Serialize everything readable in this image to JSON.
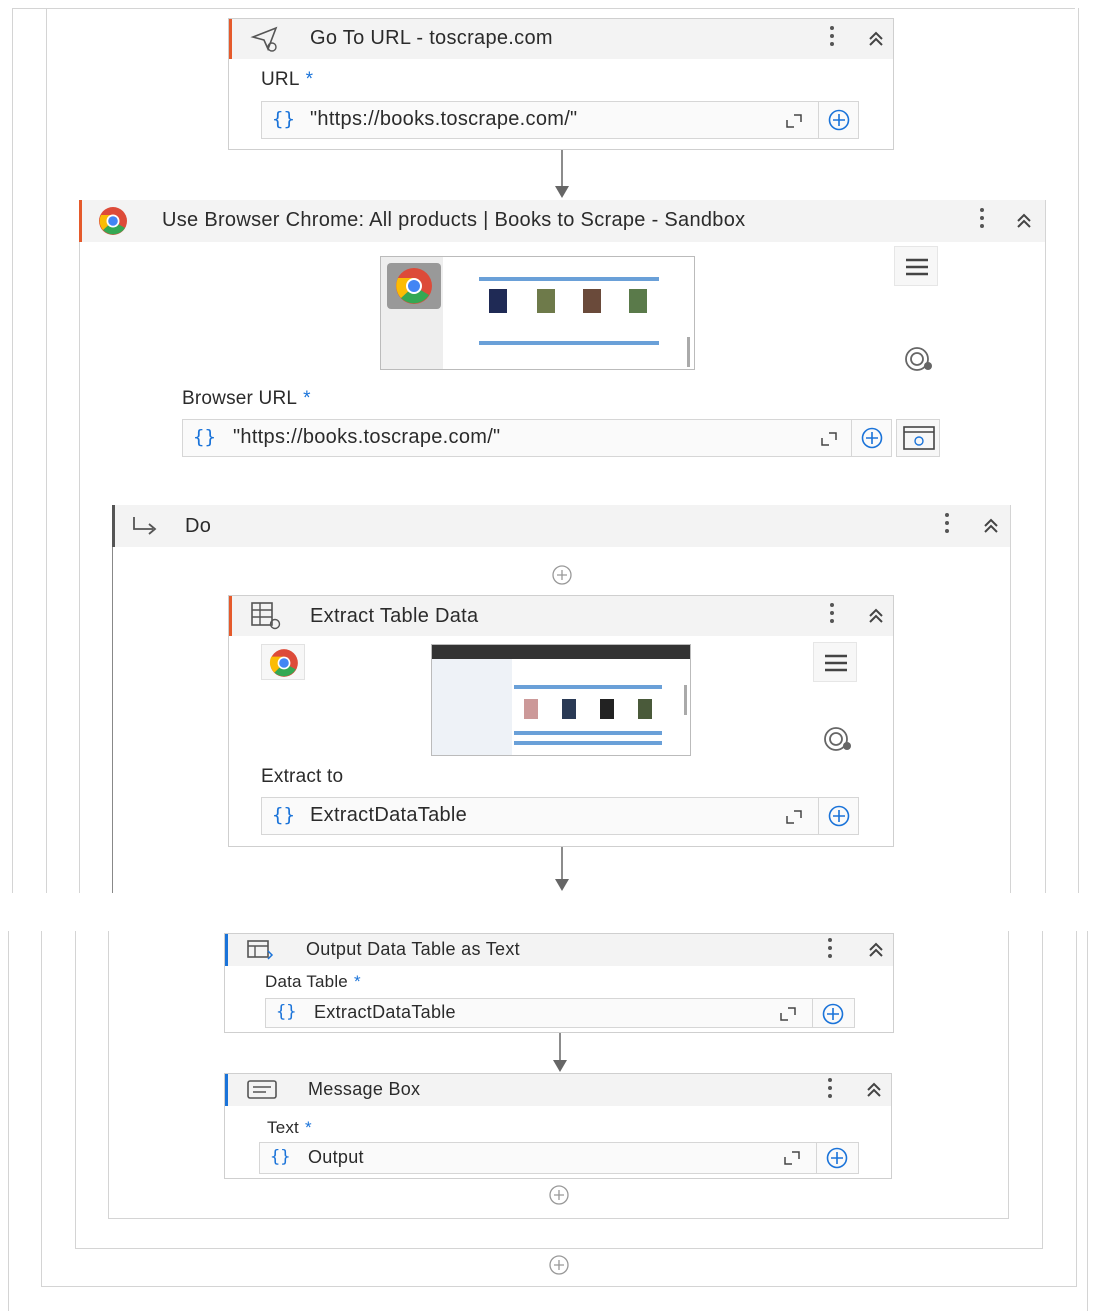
{
  "go_to_url": {
    "title": "Go To URL - toscrape.com",
    "field_label": "URL",
    "required_mark": "*",
    "value": "\"https://books.toscrape.com/\"",
    "brace": "{}"
  },
  "use_browser": {
    "title": "Use Browser Chrome: All products | Books to Scrape - Sandbox",
    "field_label": "Browser URL",
    "required_mark": "*",
    "value": "\"https://books.toscrape.com/\"",
    "brace": "{}"
  },
  "do": {
    "title": "Do"
  },
  "extract_table": {
    "title": "Extract Table Data",
    "field_label": "Extract to",
    "value": "ExtractDataTable",
    "brace": "{}"
  },
  "output_table": {
    "title": "Output Data Table as Text",
    "field_label": "Data Table",
    "required_mark": "*",
    "value": "ExtractDataTable",
    "brace": "{}"
  },
  "message_box": {
    "title": "Message Box",
    "field_label": "Text",
    "required_mark": "*",
    "value": "Output",
    "brace": "{}"
  },
  "colors": {
    "accent_orange": "#e55a2b",
    "accent_blue": "#1a73d9",
    "header_bg": "#f3f3f3"
  }
}
